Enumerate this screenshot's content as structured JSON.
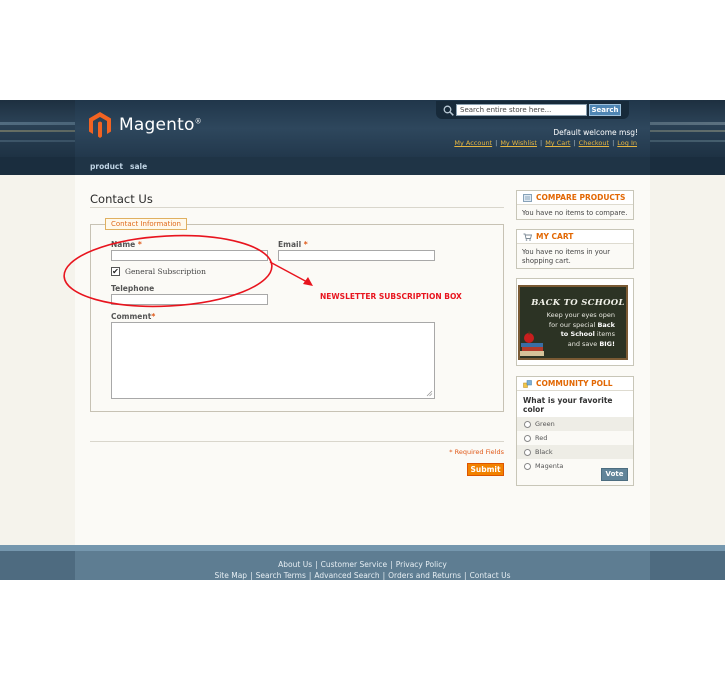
{
  "header": {
    "logo_text": "Magento",
    "logo_reg": "®",
    "search_placeholder": "Search entire store here...",
    "search_button": "Search",
    "welcome": "Default welcome msg!",
    "links": [
      "My Account",
      "My Wishlist",
      "My Cart",
      "Checkout",
      "Log In"
    ],
    "link_separator": "|"
  },
  "nav": {
    "items": [
      "product",
      "sale"
    ]
  },
  "main": {
    "page_title": "Contact Us",
    "legend": "Contact Information",
    "fields": {
      "name_label": "Name",
      "email_label": "Email",
      "telephone_label": "Telephone",
      "comment_label": "Comment",
      "required_mark": "*"
    },
    "newsletter": {
      "label": "General Subscription",
      "checked": true,
      "check_glyph": "✔"
    },
    "annotation": "NEWSLETTER SUBSCRIPTION BOX",
    "required_fields": "* Required Fields",
    "submit": "Submit"
  },
  "sidebar": {
    "compare": {
      "title": "COMPARE PRODUCTS",
      "body": "You have no items to compare."
    },
    "cart": {
      "title": "MY CART",
      "body": "You have no items in your shopping cart."
    },
    "promo": {
      "title": "BACK TO SCHOOL",
      "line1": "Keep your eyes open",
      "line2_pre": "for our special ",
      "line2_bold": "Back",
      "line3_bold": "to School",
      "line3_post": " items",
      "line4_pre": "and save ",
      "line4_bold": "BIG!"
    },
    "poll": {
      "title": "COMMUNITY POLL",
      "question": "What is your favorite color",
      "options": [
        "Green",
        "Red",
        "Black",
        "Magenta"
      ],
      "vote": "Vote"
    }
  },
  "footer": {
    "row1": [
      "About Us",
      "Customer Service",
      "Privacy Policy"
    ],
    "row2": [
      "Site Map",
      "Search Terms",
      "Advanced Search",
      "Orders and Returns",
      "Contact Us"
    ],
    "separator": "|"
  },
  "colors": {
    "accent_orange": "#e26703",
    "header_dark": "#20364a",
    "annotation_red": "#e8141e",
    "link_gold": "#e7b640"
  }
}
